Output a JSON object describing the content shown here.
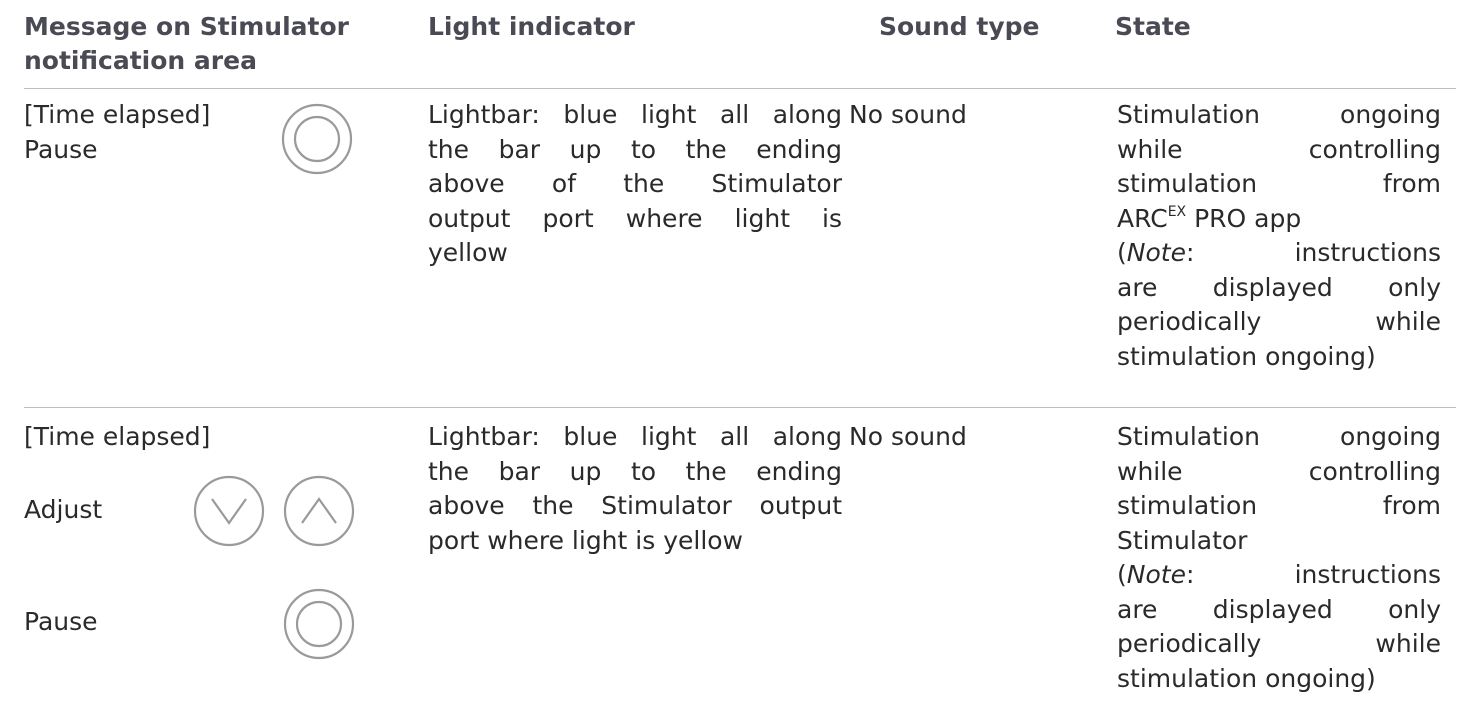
{
  "table": {
    "headers": {
      "message": "Message on Stimulator notification area",
      "light": "Light indicator",
      "sound": "Sound type",
      "state": "State"
    },
    "rows": [
      {
        "message": {
          "line1": "[Time elapsed]",
          "line2": "Pause"
        },
        "light_lines": [
          "Lightbar: blue light all along",
          "the bar up to the ending",
          "above of the Stimulator",
          "output port where light is",
          "yellow"
        ],
        "sound": "No sound",
        "state": {
          "l1": "Stimulation ongoing",
          "l2": "while controlling",
          "l3": "stimulation from",
          "l4_a": "ARC",
          "l4_sup": "EX",
          "l4_b": " PRO app",
          "note_open": "(",
          "note_word": "Note",
          "note_rest": ": instructions",
          "l6": "are displayed only",
          "l7": "periodically while",
          "l8": "stimulation ongoing)"
        }
      },
      {
        "message": {
          "line1": "[Time elapsed]",
          "line2": "Adjust",
          "line3": "Pause"
        },
        "light_lines": [
          "Lightbar: blue light all along",
          "the bar up to the ending",
          "above the Stimulator output",
          "port where light is yellow"
        ],
        "sound": "No sound",
        "state": {
          "l1": "Stimulation ongoing",
          "l2": "while controlling",
          "l3": "stimulation from",
          "l4": "Stimulator",
          "note_open": "(",
          "note_word": "Note",
          "note_rest": ": instructions",
          "l6": "are displayed only",
          "l7": "periodically while",
          "l8": "stimulation ongoing)"
        }
      }
    ]
  },
  "icons": {
    "pause": "pause-ring-icon",
    "down": "chevron-down-icon",
    "up": "chevron-up-icon"
  },
  "colors": {
    "header_text": "#4a4a55",
    "body_text": "#2a2a2a",
    "rule": "#bdbdbd",
    "icon_stroke": "#9a9a9a"
  }
}
